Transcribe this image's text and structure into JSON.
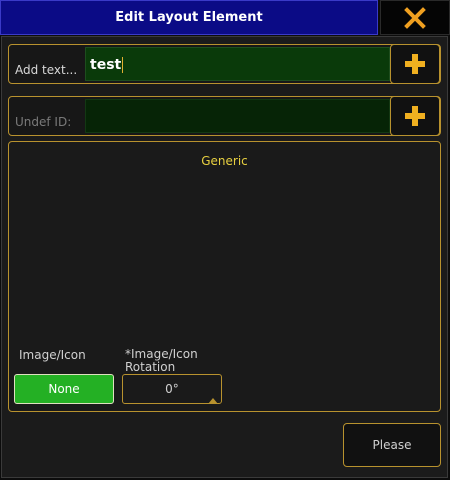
{
  "window": {
    "title": "Edit Layout Element"
  },
  "colors": {
    "accent": "#b8922e",
    "title_bg": "#0b0b86",
    "input_bg": "#0a3a0a",
    "selected_green": "#24b024",
    "heading_yellow": "#e8d040",
    "close_orange": "#f0a020"
  },
  "text_field": {
    "label": "Add text...",
    "value": "test",
    "add_icon": "plus-icon"
  },
  "id_field": {
    "label": "Undef ID:",
    "value": "",
    "add_icon": "plus-icon"
  },
  "generic": {
    "title": "Generic",
    "image_icon_label": "Image/Icon",
    "image_icon_value": "None",
    "rotation_label": "*Image/Icon Rotation",
    "rotation_value": "0°"
  },
  "footer": {
    "please_label": "Please"
  },
  "icons": {
    "close": "close-icon"
  }
}
